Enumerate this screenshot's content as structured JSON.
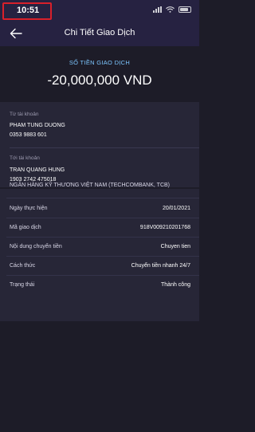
{
  "status_bar": {
    "time": "10:51"
  },
  "header": {
    "title": "Chi Tiết Giao Dịch"
  },
  "amount": {
    "label": "SỐ TIỀN GIAO DỊCH",
    "value": "-20,000,000 VND"
  },
  "from": {
    "label": "Từ tài khoản",
    "name": "PHAM TUNG DUONG",
    "account": "0353 9883 601"
  },
  "to": {
    "label": "Tới tài khoản",
    "name": "TRAN QUANG HUNG",
    "account": "1903 2742 475018",
    "bank": "NGÂN HÀNG KỸ THƯƠNG VIỆT NAM (TECHCOMBANK, TCB)"
  },
  "details": [
    {
      "key": "Ngày thực hiện",
      "value": "20/01/2021"
    },
    {
      "key": "Mã giao dịch",
      "value": "918V009210201768"
    },
    {
      "key": "Nội dung chuyển tiền",
      "value": "Chuyen tien"
    },
    {
      "key": "Cách thức",
      "value": "Chuyển tiền nhanh 24/7"
    },
    {
      "key": "Trạng thái",
      "value": "Thành công"
    }
  ]
}
